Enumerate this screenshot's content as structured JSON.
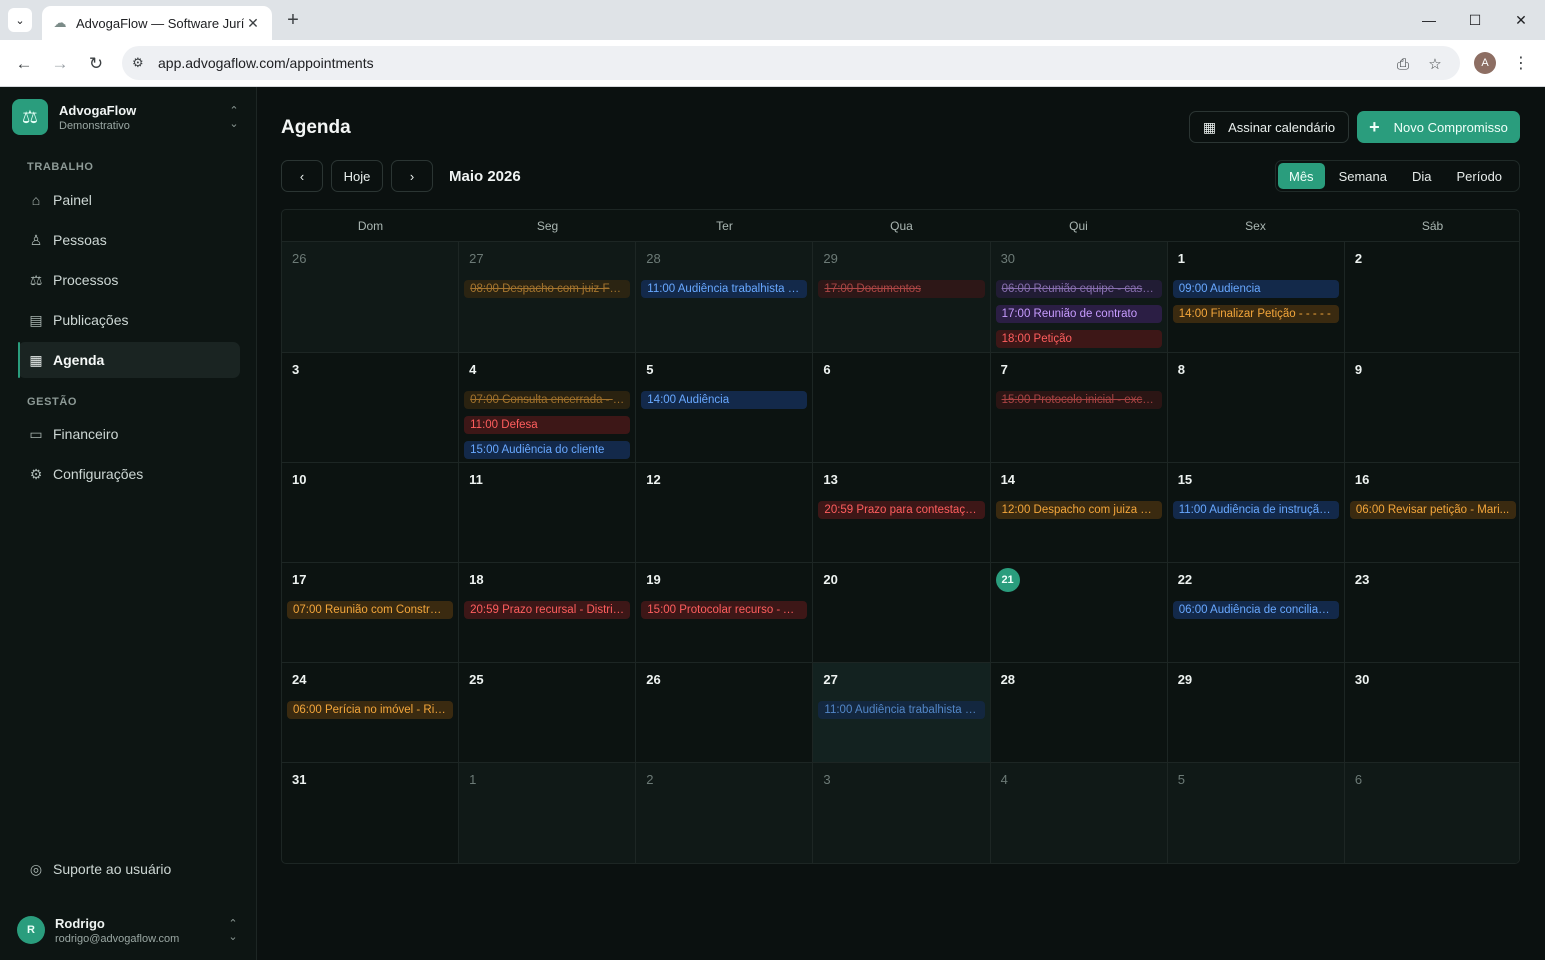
{
  "browser": {
    "tab_title": "AdvogaFlow — Software Jurídico",
    "url": "app.advogaflow.com/appointments",
    "profile_initial": "A"
  },
  "sidebar": {
    "brand_name": "AdvogaFlow",
    "brand_sub": "Demonstrativo",
    "section_work": "TRABALHO",
    "section_mgmt": "GESTÃO",
    "items": [
      {
        "label": "Painel",
        "icon": "home-icon"
      },
      {
        "label": "Pessoas",
        "icon": "user-icon"
      },
      {
        "label": "Processos",
        "icon": "scale-icon"
      },
      {
        "label": "Publicações",
        "icon": "newspaper-icon"
      },
      {
        "label": "Agenda",
        "icon": "calendar-icon"
      },
      {
        "label": "Financeiro",
        "icon": "wallet-icon"
      },
      {
        "label": "Configurações",
        "icon": "gear-icon"
      }
    ],
    "support": "Suporte ao usuário",
    "user_name": "Rodrigo",
    "user_email": "rodrigo@advogaflow.com",
    "user_initial": "R"
  },
  "header": {
    "title": "Agenda",
    "subscribe_label": "Assinar calendário",
    "new_label": "Novo Compromisso",
    "today_label": "Hoje",
    "month_label": "Maio 2026",
    "views": [
      "Mês",
      "Semana",
      "Dia",
      "Período"
    ],
    "active_view": "Mês"
  },
  "calendar": {
    "weekdays": [
      "Dom",
      "Seg",
      "Ter",
      "Qua",
      "Qui",
      "Sex",
      "Sáb"
    ],
    "weeks": [
      {
        "days": [
          {
            "num": "26",
            "outside": true,
            "events": []
          },
          {
            "num": "27",
            "outside": true,
            "events": [
              {
                "text": "08:00 Despacho com juiz Fer...",
                "color": "orange",
                "done": true
              }
            ]
          },
          {
            "num": "28",
            "outside": true,
            "events": [
              {
                "text": "11:00 Audiência trabalhista - ...",
                "color": "blue"
              }
            ]
          },
          {
            "num": "29",
            "outside": true,
            "events": [
              {
                "text": "17:00 Documentos",
                "color": "red",
                "done": true
              }
            ]
          },
          {
            "num": "30",
            "outside": true,
            "events": [
              {
                "text": "06:00 Reunião equipe - caso...",
                "color": "purple",
                "done": true
              },
              {
                "text": "17:00 Reunião de contrato",
                "color": "purple"
              },
              {
                "text": "18:00 Petição",
                "color": "red"
              }
            ]
          },
          {
            "num": "1",
            "events": [
              {
                "text": "09:00 Audiencia",
                "color": "blue"
              },
              {
                "text": "14:00 Finalizar Petição - - - - -",
                "color": "orange"
              }
            ]
          },
          {
            "num": "2",
            "events": []
          }
        ]
      },
      {
        "days": [
          {
            "num": "3",
            "events": []
          },
          {
            "num": "4",
            "events": [
              {
                "text": "07:00 Consulta encerrada - e...",
                "color": "orange",
                "done": true
              },
              {
                "text": "11:00 Defesa",
                "color": "red"
              },
              {
                "text": "15:00 Audiência do cliente",
                "color": "blue"
              }
            ]
          },
          {
            "num": "5",
            "events": [
              {
                "text": "14:00 Audiência",
                "color": "blue"
              }
            ]
          },
          {
            "num": "6",
            "events": []
          },
          {
            "num": "7",
            "events": [
              {
                "text": "15:00 Protocolo inicial - exce...",
                "color": "red",
                "done": true
              }
            ]
          },
          {
            "num": "8",
            "events": []
          },
          {
            "num": "9",
            "events": []
          }
        ]
      },
      {
        "days": [
          {
            "num": "10",
            "events": []
          },
          {
            "num": "11",
            "events": []
          },
          {
            "num": "12",
            "events": []
          },
          {
            "num": "13",
            "events": [
              {
                "text": "20:59 Prazo para contestaçã...",
                "color": "red"
              }
            ]
          },
          {
            "num": "14",
            "events": [
              {
                "text": "12:00 Despacho com juiza Pa...",
                "color": "orange"
              }
            ]
          },
          {
            "num": "15",
            "events": [
              {
                "text": "11:00 Audiência de instrução ...",
                "color": "blue"
              }
            ]
          },
          {
            "num": "16",
            "events": [
              {
                "text": "06:00 Revisar petição - Mari...",
                "color": "orange"
              }
            ]
          }
        ]
      },
      {
        "days": [
          {
            "num": "17",
            "events": [
              {
                "text": "07:00 Reunião com Construt...",
                "color": "orange"
              }
            ]
          },
          {
            "num": "18",
            "events": [
              {
                "text": "20:59 Prazo recursal - Distrib...",
                "color": "red"
              }
            ]
          },
          {
            "num": "19",
            "events": [
              {
                "text": "15:00 Protocolar recurso - An...",
                "color": "red"
              }
            ]
          },
          {
            "num": "20",
            "events": []
          },
          {
            "num": "21",
            "today": true,
            "events": []
          },
          {
            "num": "22",
            "events": [
              {
                "text": "06:00 Audiência de conciliaç...",
                "color": "blue"
              }
            ]
          },
          {
            "num": "23",
            "events": []
          }
        ]
      },
      {
        "days": [
          {
            "num": "24",
            "events": [
              {
                "text": "06:00 Perícia no imóvel - Ric...",
                "color": "orange"
              }
            ]
          },
          {
            "num": "25",
            "events": []
          },
          {
            "num": "26",
            "events": []
          },
          {
            "num": "27",
            "highlight": true,
            "events": [
              {
                "text": "11:00 Audiência trabalhista - ...",
                "color": "blue",
                "faded": true
              }
            ]
          },
          {
            "num": "28",
            "events": []
          },
          {
            "num": "29",
            "events": []
          },
          {
            "num": "30",
            "events": []
          }
        ]
      },
      {
        "days": [
          {
            "num": "31",
            "events": []
          },
          {
            "num": "1",
            "outside": true,
            "events": []
          },
          {
            "num": "2",
            "outside": true,
            "events": []
          },
          {
            "num": "3",
            "outside": true,
            "events": []
          },
          {
            "num": "4",
            "outside": true,
            "events": []
          },
          {
            "num": "5",
            "outside": true,
            "events": []
          },
          {
            "num": "6",
            "outside": true,
            "events": []
          }
        ]
      }
    ]
  },
  "colors": {
    "accent": "#2a9d7d",
    "event_blue": "#68a8ff",
    "event_orange": "#f3a63b",
    "event_red": "#ff5e5e",
    "event_purple": "#c79cff"
  }
}
